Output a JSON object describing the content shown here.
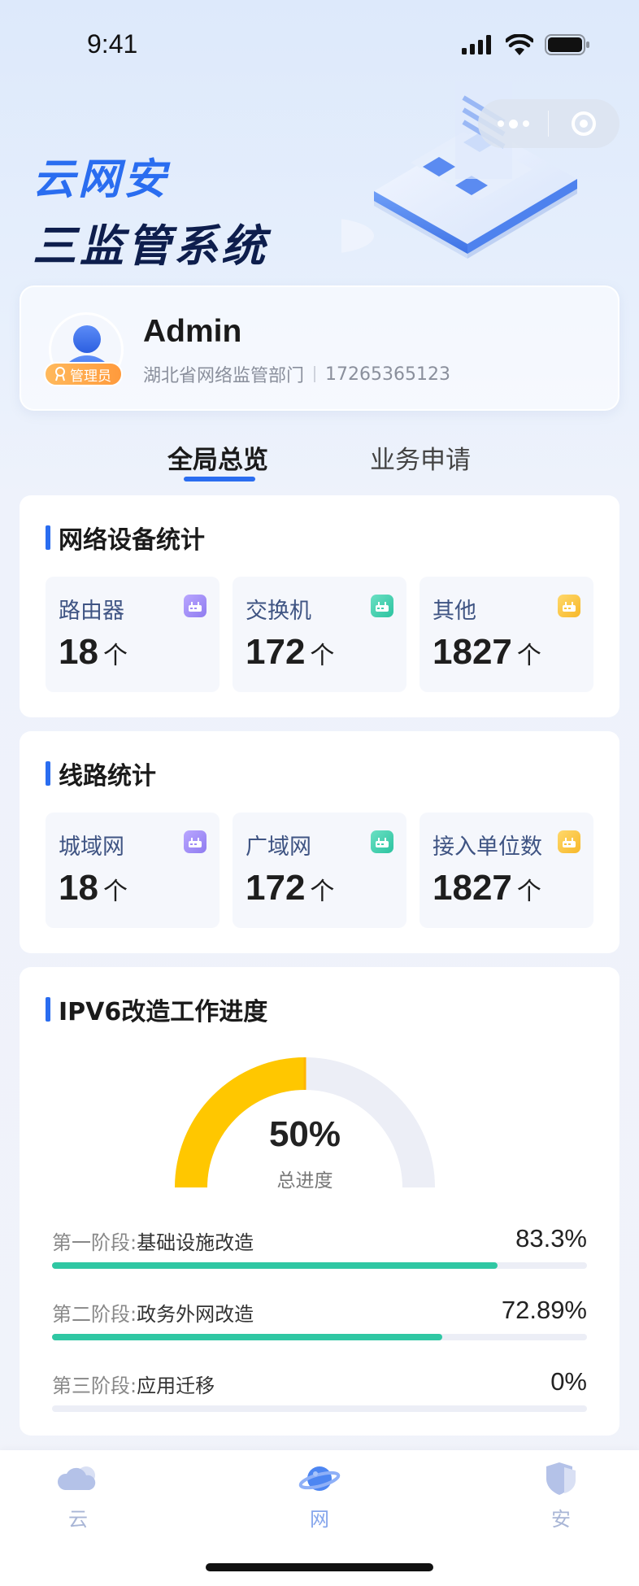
{
  "status_bar": {
    "time": "9:41"
  },
  "hero": {
    "line1": "云网安",
    "line2": "三监管系统"
  },
  "user": {
    "name": "Admin",
    "role_badge": "管理员",
    "department": "湖北省网络监管部门",
    "phone": "17265365123"
  },
  "tabs": [
    {
      "label": "全局总览",
      "active": true
    },
    {
      "label": "业务申请",
      "active": false
    }
  ],
  "device_stats": {
    "title": "网络设备统计",
    "items": [
      {
        "label": "路由器",
        "value": "18",
        "unit": "个",
        "icon": "router-icon",
        "color": "#9f8cf6"
      },
      {
        "label": "交换机",
        "value": "172",
        "unit": "个",
        "icon": "switch-icon",
        "color": "#3fcfad"
      },
      {
        "label": "其他",
        "value": "1827",
        "unit": "个",
        "icon": "other-device-icon",
        "color": "#f9c341"
      }
    ]
  },
  "line_stats": {
    "title": "线路统计",
    "items": [
      {
        "label": "城域网",
        "value": "18",
        "unit": "个",
        "icon": "man-icon",
        "color": "#9f8cf6"
      },
      {
        "label": "广域网",
        "value": "172",
        "unit": "个",
        "icon": "wan-icon",
        "color": "#3fcfad"
      },
      {
        "label": "接入单位数",
        "value": "1827",
        "unit": "个",
        "icon": "access-unit-icon",
        "color": "#f9c341"
      }
    ]
  },
  "ipv6": {
    "title": "IPV6改造工作进度",
    "overall_percent": 50,
    "overall_text": "50%",
    "overall_label": "总进度",
    "phases": [
      {
        "stage": "第一阶段:",
        "name": "基础设施改造",
        "value_text": "83.3%",
        "percent": 83.3
      },
      {
        "stage": "第二阶段:",
        "name": "政务外网改造",
        "value_text": "72.89%",
        "percent": 72.89
      },
      {
        "stage": "第三阶段:",
        "name": "应用迁移",
        "value_text": "0%",
        "percent": 0
      }
    ]
  },
  "tabbar": [
    {
      "label": "云",
      "icon": "cloud-icon",
      "active": false
    },
    {
      "label": "网",
      "icon": "planet-icon",
      "active": true
    },
    {
      "label": "安",
      "icon": "shield-icon",
      "active": false
    }
  ],
  "colors": {
    "accent": "#2a6df0",
    "gauge_fill": "#ffc700",
    "progress_fill": "#2fc7a3",
    "hero_dark": "#0e1e4d"
  }
}
